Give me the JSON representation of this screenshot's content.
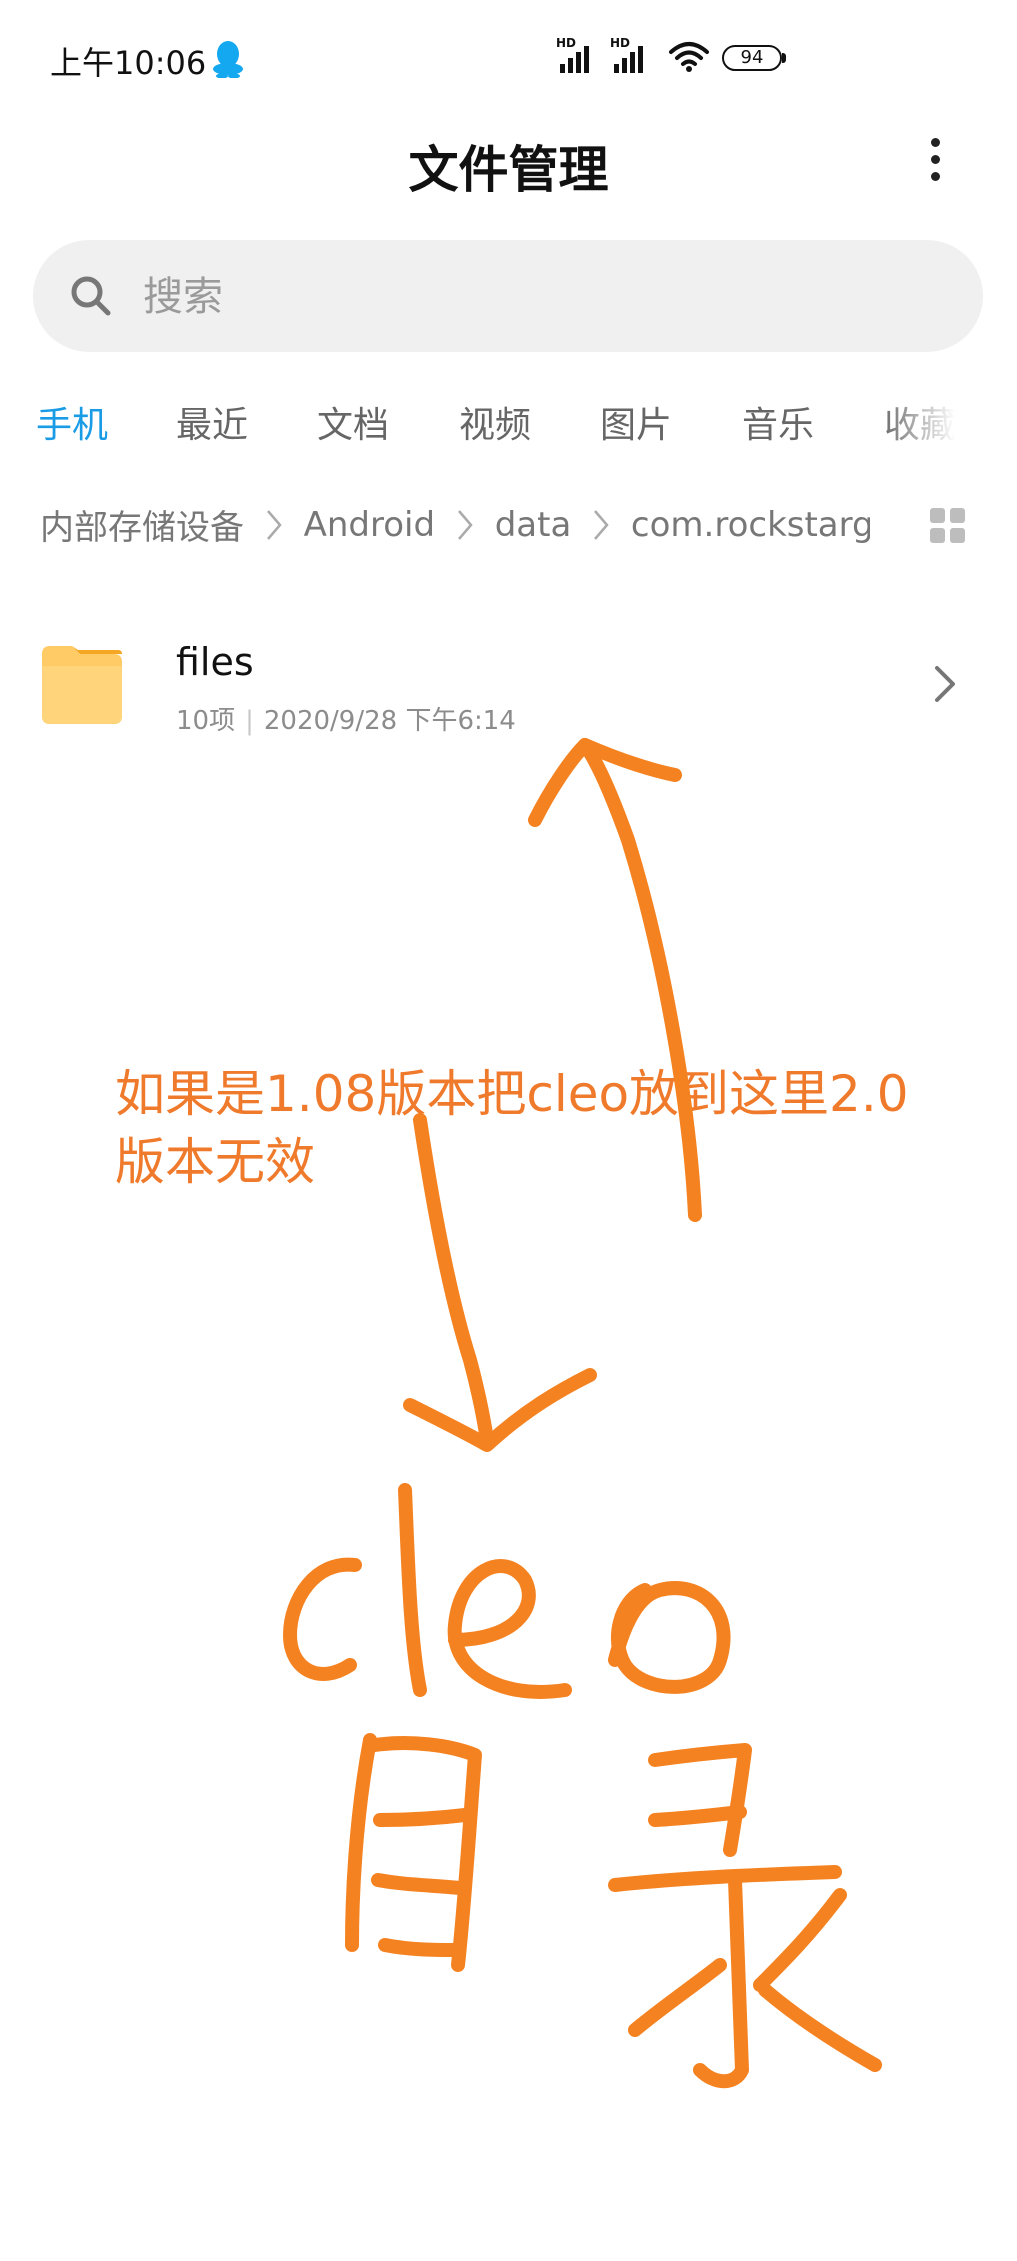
{
  "status_bar": {
    "time": "上午10:06",
    "signal_1_label": "HD",
    "signal_2_label": "HD",
    "battery": "94"
  },
  "header": {
    "title": "文件管理"
  },
  "search": {
    "placeholder": "搜索"
  },
  "tabs": [
    {
      "label": "手机",
      "active": true
    },
    {
      "label": "最近",
      "active": false
    },
    {
      "label": "文档",
      "active": false
    },
    {
      "label": "视频",
      "active": false
    },
    {
      "label": "图片",
      "active": false
    },
    {
      "label": "音乐",
      "active": false
    },
    {
      "label": "收藏",
      "active": false
    }
  ],
  "breadcrumb": [
    "内部存储设备",
    "Android",
    "data",
    "com.rockstargames"
  ],
  "files": [
    {
      "name": "files",
      "count": "10项",
      "date": "2020/9/28 下午6:14",
      "icon": "folder-icon"
    }
  ],
  "annotation": {
    "text": "如果是1.08版本把cleo放到这里2.0版本无效",
    "handwriting": "cleo目录"
  },
  "colors": {
    "accent": "#1a9be6",
    "folder": "#ffcb66",
    "annotation": "#f58220"
  }
}
